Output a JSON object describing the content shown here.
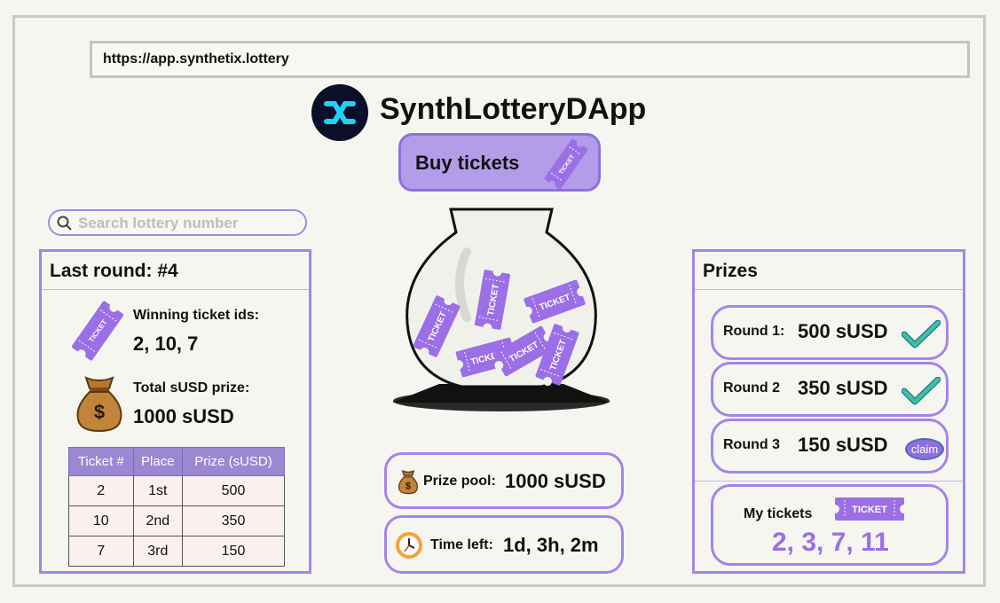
{
  "browser": {
    "url": "https://app.synthetix.lottery"
  },
  "app": {
    "title": "SynthLotteryDApp",
    "buy_label": "Buy tickets"
  },
  "search": {
    "placeholder": "Search lottery number"
  },
  "ticket_text": "TICKET",
  "last_round": {
    "title": "Last round: #4",
    "winning_label": "Winning ticket ids:",
    "winning_ids": "2, 10, 7",
    "prize_label": "Total sUSD prize:",
    "prize_value": "1000 sUSD",
    "currency_symbol": "$",
    "table": {
      "headers": [
        "Ticket #",
        "Place",
        "Prize (sUSD)"
      ],
      "rows": [
        [
          "2",
          "1st",
          "500"
        ],
        [
          "10",
          "2nd",
          "350"
        ],
        [
          "7",
          "3rd",
          "150"
        ]
      ]
    }
  },
  "pool": {
    "prize_label": "Prize pool:",
    "prize_value": "1000 sUSD",
    "time_label": "Time left:",
    "time_value": "1d, 3h, 2m"
  },
  "prizes": {
    "title": "Prizes",
    "rounds": [
      {
        "label": "Round 1:",
        "amount": "500 sUSD",
        "status": "check-icon"
      },
      {
        "label": "Round 2",
        "amount": "350 sUSD",
        "status": "check-icon"
      },
      {
        "label": "Round 3",
        "amount": "150 sUSD",
        "status": "claim"
      }
    ],
    "claim_label": "claim",
    "my_tickets_label": "My tickets",
    "my_tickets_value": "2, 3, 7, 11"
  },
  "colors": {
    "accent": "#a484ea",
    "ticket": "#9b6fe6",
    "check": "#3ec49a",
    "logo_bg": "#0b0f2a",
    "logo_mark": "#1fd1f5"
  }
}
